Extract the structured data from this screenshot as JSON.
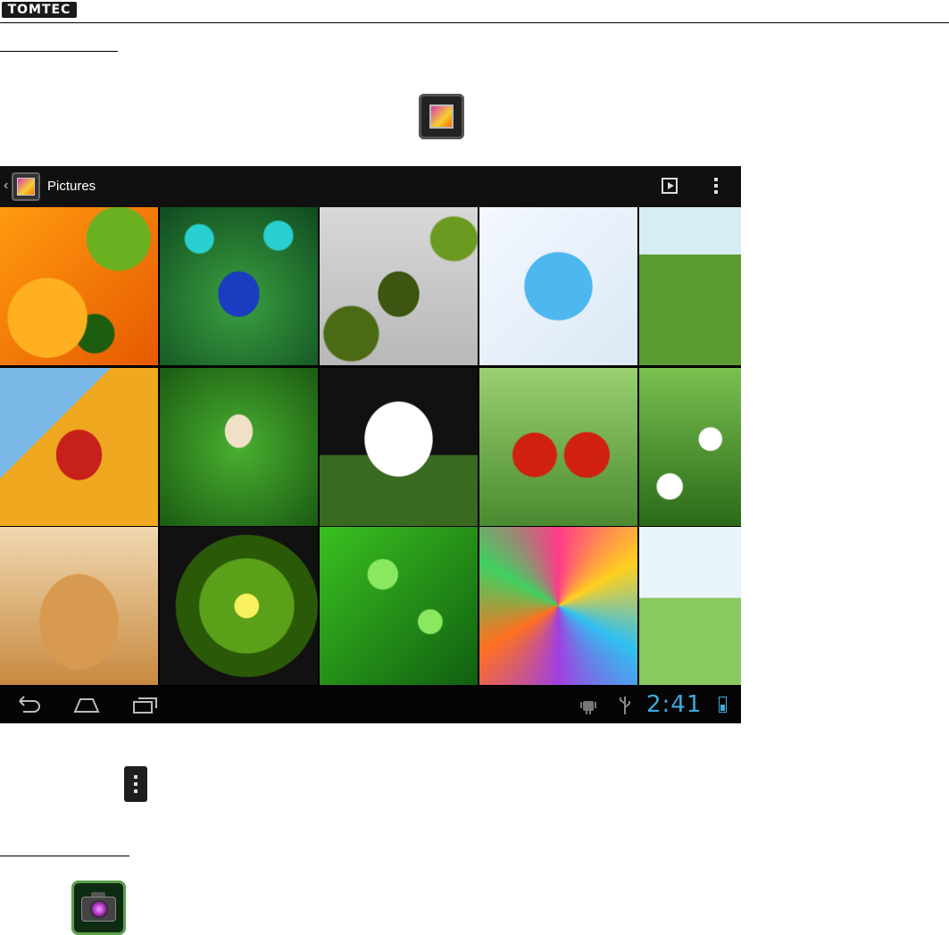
{
  "header": {
    "logo_text": "TOMTEC"
  },
  "device": {
    "actionbar": {
      "title": "Pictures"
    },
    "status": {
      "clock": "2:41"
    }
  },
  "icons": {
    "gallery_app": "gallery-icon",
    "play": "slideshow-play-icon",
    "overflow": "overflow-menu-icon",
    "camera_app": "camera-icon"
  },
  "thumbnails": [
    "oranges-kiwi-photo",
    "peacock-photo",
    "green-stones-photo",
    "blue-heart-photo",
    "flower-meadow-photo",
    "ladybug-photo",
    "mushroom-grass-photo",
    "calla-lily-photo",
    "cherries-photo",
    "daisies-photo",
    "puppy-photo",
    "kiwi-slice-photo",
    "water-drops-leaf-photo",
    "paper-stars-photo",
    "fantasy-garden-photo"
  ],
  "colors": {
    "accent": "#3fa9dc",
    "actionbar": "#101010"
  }
}
